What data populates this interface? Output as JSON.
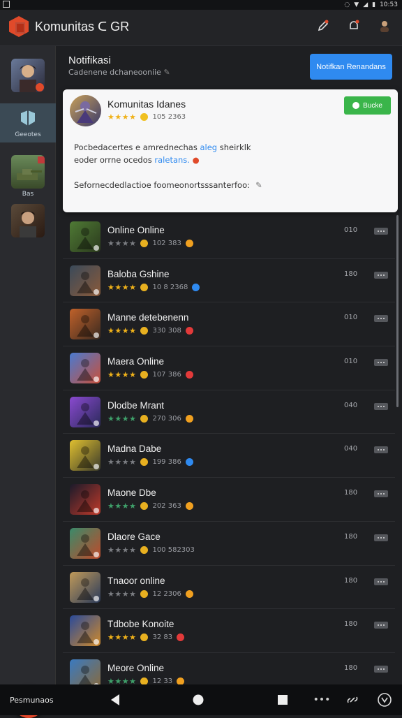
{
  "status_bar": {
    "time": "10:53"
  },
  "app": {
    "title": "Komunitas ᑕ GR"
  },
  "header": {
    "title": "Notifikasi",
    "subtitle": "Cadenene dchaneooniie",
    "primary_button": "Notifkan Renandans"
  },
  "sidebar": {
    "items": [
      {
        "icon": "profile-avatar-icon",
        "label": ""
      },
      {
        "icon": "community-icon",
        "label": "Geeotes"
      },
      {
        "icon": "tank-game-icon",
        "label": "Bas"
      },
      {
        "icon": "player-avatar-icon",
        "label": ""
      }
    ]
  },
  "featured": {
    "title": "Komunitas Idanes",
    "stars": "★★★★",
    "count": "105 2363",
    "join_label": "Bucke",
    "description_a": "Pocbedacertes e amrednechas",
    "description_tag": "aleg",
    "description_b": "sheirklk",
    "description_c": "eoder orrne ocedos",
    "description_tag2": "raletans.",
    "note": "Sefornecdedlactioe foomeonortsssanterfoo:"
  },
  "games": [
    {
      "title": "Online Online",
      "stars": "★★★★",
      "count": "102 383",
      "num": "010",
      "star_color": "#7b7d82",
      "badge": "#f0a020",
      "thumb": [
        "#4f7a35",
        "#2b3a1d"
      ]
    },
    {
      "title": "Baloba Gshine",
      "stars": "★★★★",
      "count": "10 8 2368",
      "num": "180",
      "star_color": "#f0b21a",
      "badge": "#2f8af0",
      "thumb": [
        "#3a4a5a",
        "#8a5a3a"
      ]
    },
    {
      "title": "Manne detebenenn",
      "stars": "★★★★",
      "count": "330 308",
      "num": "010",
      "star_color": "#f0b21a",
      "badge": "#e23a3a",
      "thumb": [
        "#c0612a",
        "#3a2a20"
      ]
    },
    {
      "title": "Maera Online",
      "stars": "★★★★",
      "count": "107 386",
      "num": "010",
      "star_color": "#f0b21a",
      "badge": "#e23a3a",
      "thumb": [
        "#4a7ad0",
        "#c8503a"
      ]
    },
    {
      "title": "Dlodbe Mrant",
      "stars": "★★★★",
      "count": "270 306",
      "num": "040",
      "star_color": "#3fa06a",
      "badge": "#f0a020",
      "thumb": [
        "#8a4ad0",
        "#2a2a5a"
      ]
    },
    {
      "title": "Madna Dabe",
      "stars": "★★★★",
      "count": "199 386",
      "num": "040",
      "star_color": "#7b7d82",
      "badge": "#2f8af0",
      "thumb": [
        "#e0c030",
        "#3a3a2a"
      ]
    },
    {
      "title": "Maone Dbe",
      "stars": "★★★★",
      "count": "202 363",
      "num": "180",
      "star_color": "#3fa06a",
      "badge": "#f0a020",
      "thumb": [
        "#1a1a2a",
        "#c03a2a"
      ]
    },
    {
      "title": "Dlaore Gace",
      "stars": "★★★★",
      "count": "100 582303",
      "num": "180",
      "star_color": "#7b7d82",
      "badge": "",
      "thumb": [
        "#3a8a6a",
        "#c04a2a"
      ]
    },
    {
      "title": "Tnaoor online",
      "stars": "★★★★",
      "count": "12 2306",
      "num": "180",
      "star_color": "#7b7d82",
      "badge": "#f0a020",
      "thumb": [
        "#c09a5a",
        "#2a3a5a"
      ]
    },
    {
      "title": "Tdbobe Konoite",
      "stars": "★★★★",
      "count": "32 83",
      "num": "180",
      "star_color": "#f0b21a",
      "badge": "#e23a3a",
      "thumb": [
        "#2a4a9a",
        "#d08a2a"
      ]
    },
    {
      "title": "Meore Online",
      "stars": "★★★★",
      "count": "12 33",
      "num": "180",
      "star_color": "#3fa06a",
      "badge": "#f0a020",
      "thumb": [
        "#3a7ac0",
        "#8a6a3a"
      ]
    }
  ],
  "nav": {
    "label": "Pesmunaos"
  },
  "colors": {
    "accent": "#2f8af0",
    "join": "#3ab54a",
    "brand": "#e04a2a"
  }
}
